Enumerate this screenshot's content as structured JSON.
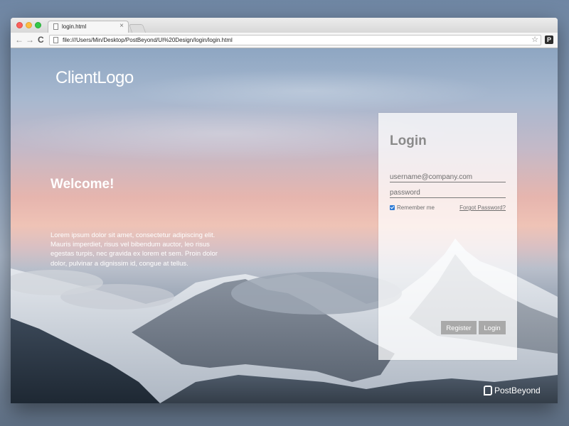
{
  "browser": {
    "tab_title": "login.html",
    "tab_close": "×",
    "address": "file:///Users/Min/Desktop/PostBeyond/UI%20Design/login/login.html",
    "back_glyph": "←",
    "forward_glyph": "→",
    "reload_glyph": "C",
    "star_glyph": "☆",
    "extension_glyph": "P"
  },
  "page": {
    "client_logo": "ClientLogo",
    "welcome": "Welcome!",
    "intro": "Lorem ipsum dolor sit amet, consectetur adipiscing elit. Mauris imperdiet, risus vel bibendum auctor, leo risus egestas turpis, nec gravida ex lorem et sem. Proin dolor dolor, pulvinar a dignissim id, congue at tellus."
  },
  "login": {
    "title": "Login",
    "username_placeholder": "username@company.com",
    "password_placeholder": "password",
    "remember_label": "Remember me",
    "remember_checked": true,
    "forgot_label": "Forgot Password?",
    "register_label": "Register",
    "login_label": "Login"
  },
  "footer": {
    "brand": "PostBeyond"
  },
  "icons": {
    "traffic_red": "close-traffic-light",
    "traffic_yellow": "minimize-traffic-light",
    "traffic_green": "maximize-traffic-light",
    "tab": "document-icon",
    "brand": "postbeyond-logo-icon"
  },
  "colors": {
    "accent_checkbox": "#2e7bd6",
    "button_bg": "#a9a9a9",
    "panel_title": "#8a8a8a"
  }
}
